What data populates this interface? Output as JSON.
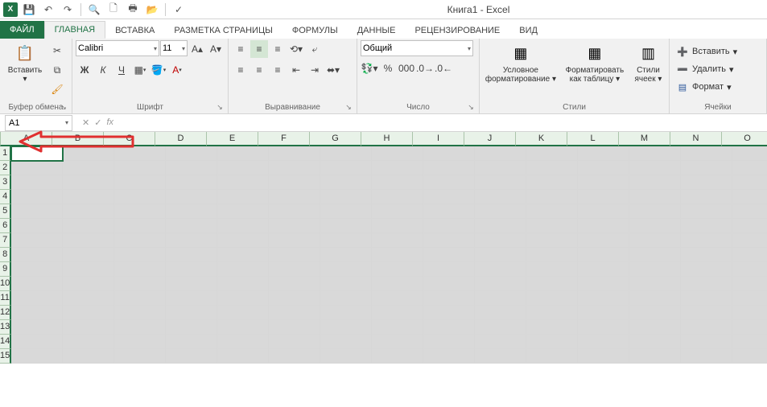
{
  "title": "Книга1 - Excel",
  "qat": {
    "save": "💾",
    "undo": "↶",
    "redo": "↷",
    "preview": "🔍",
    "new": "🗋",
    "quickprint": "🖶",
    "open": "📂",
    "spell": "✓"
  },
  "tabs": {
    "file": "ФАЙЛ",
    "items": [
      "ГЛАВНАЯ",
      "ВСТАВКА",
      "РАЗМЕТКА СТРАНИЦЫ",
      "ФОРМУЛЫ",
      "ДАННЫЕ",
      "РЕЦЕНЗИРОВАНИЕ",
      "ВИД"
    ],
    "active_index": 0
  },
  "ribbon": {
    "clipboard": {
      "label": "Буфер обмена",
      "paste": "Вставить"
    },
    "font": {
      "label": "Шрифт",
      "name": "Calibri",
      "size": "11",
      "bold": "Ж",
      "italic": "К",
      "underline": "Ч"
    },
    "alignment": {
      "label": "Выравнивание"
    },
    "number": {
      "label": "Число",
      "format": "Общий"
    },
    "styles": {
      "label": "Стили",
      "condfmt": "Условное форматирование",
      "condfmt1": "Условное",
      "condfmt2": "форматирование",
      "astable": "Форматировать как таблицу",
      "astable1": "Форматировать",
      "astable2": "как таблицу",
      "cellstyles": "Стили ячеек",
      "cellstyles1": "Стили",
      "cellstyles2": "ячеек"
    },
    "cells": {
      "label": "Ячейки",
      "insert": "Вставить",
      "delete": "Удалить",
      "format": "Формат"
    }
  },
  "namebox": "A1",
  "columns": [
    "A",
    "B",
    "C",
    "D",
    "E",
    "F",
    "G",
    "H",
    "I",
    "J",
    "K",
    "L",
    "M",
    "N",
    "O"
  ],
  "rows": [
    "1",
    "2",
    "3",
    "4",
    "5",
    "6",
    "7",
    "8",
    "9",
    "10",
    "11",
    "12",
    "13",
    "14",
    "15"
  ]
}
